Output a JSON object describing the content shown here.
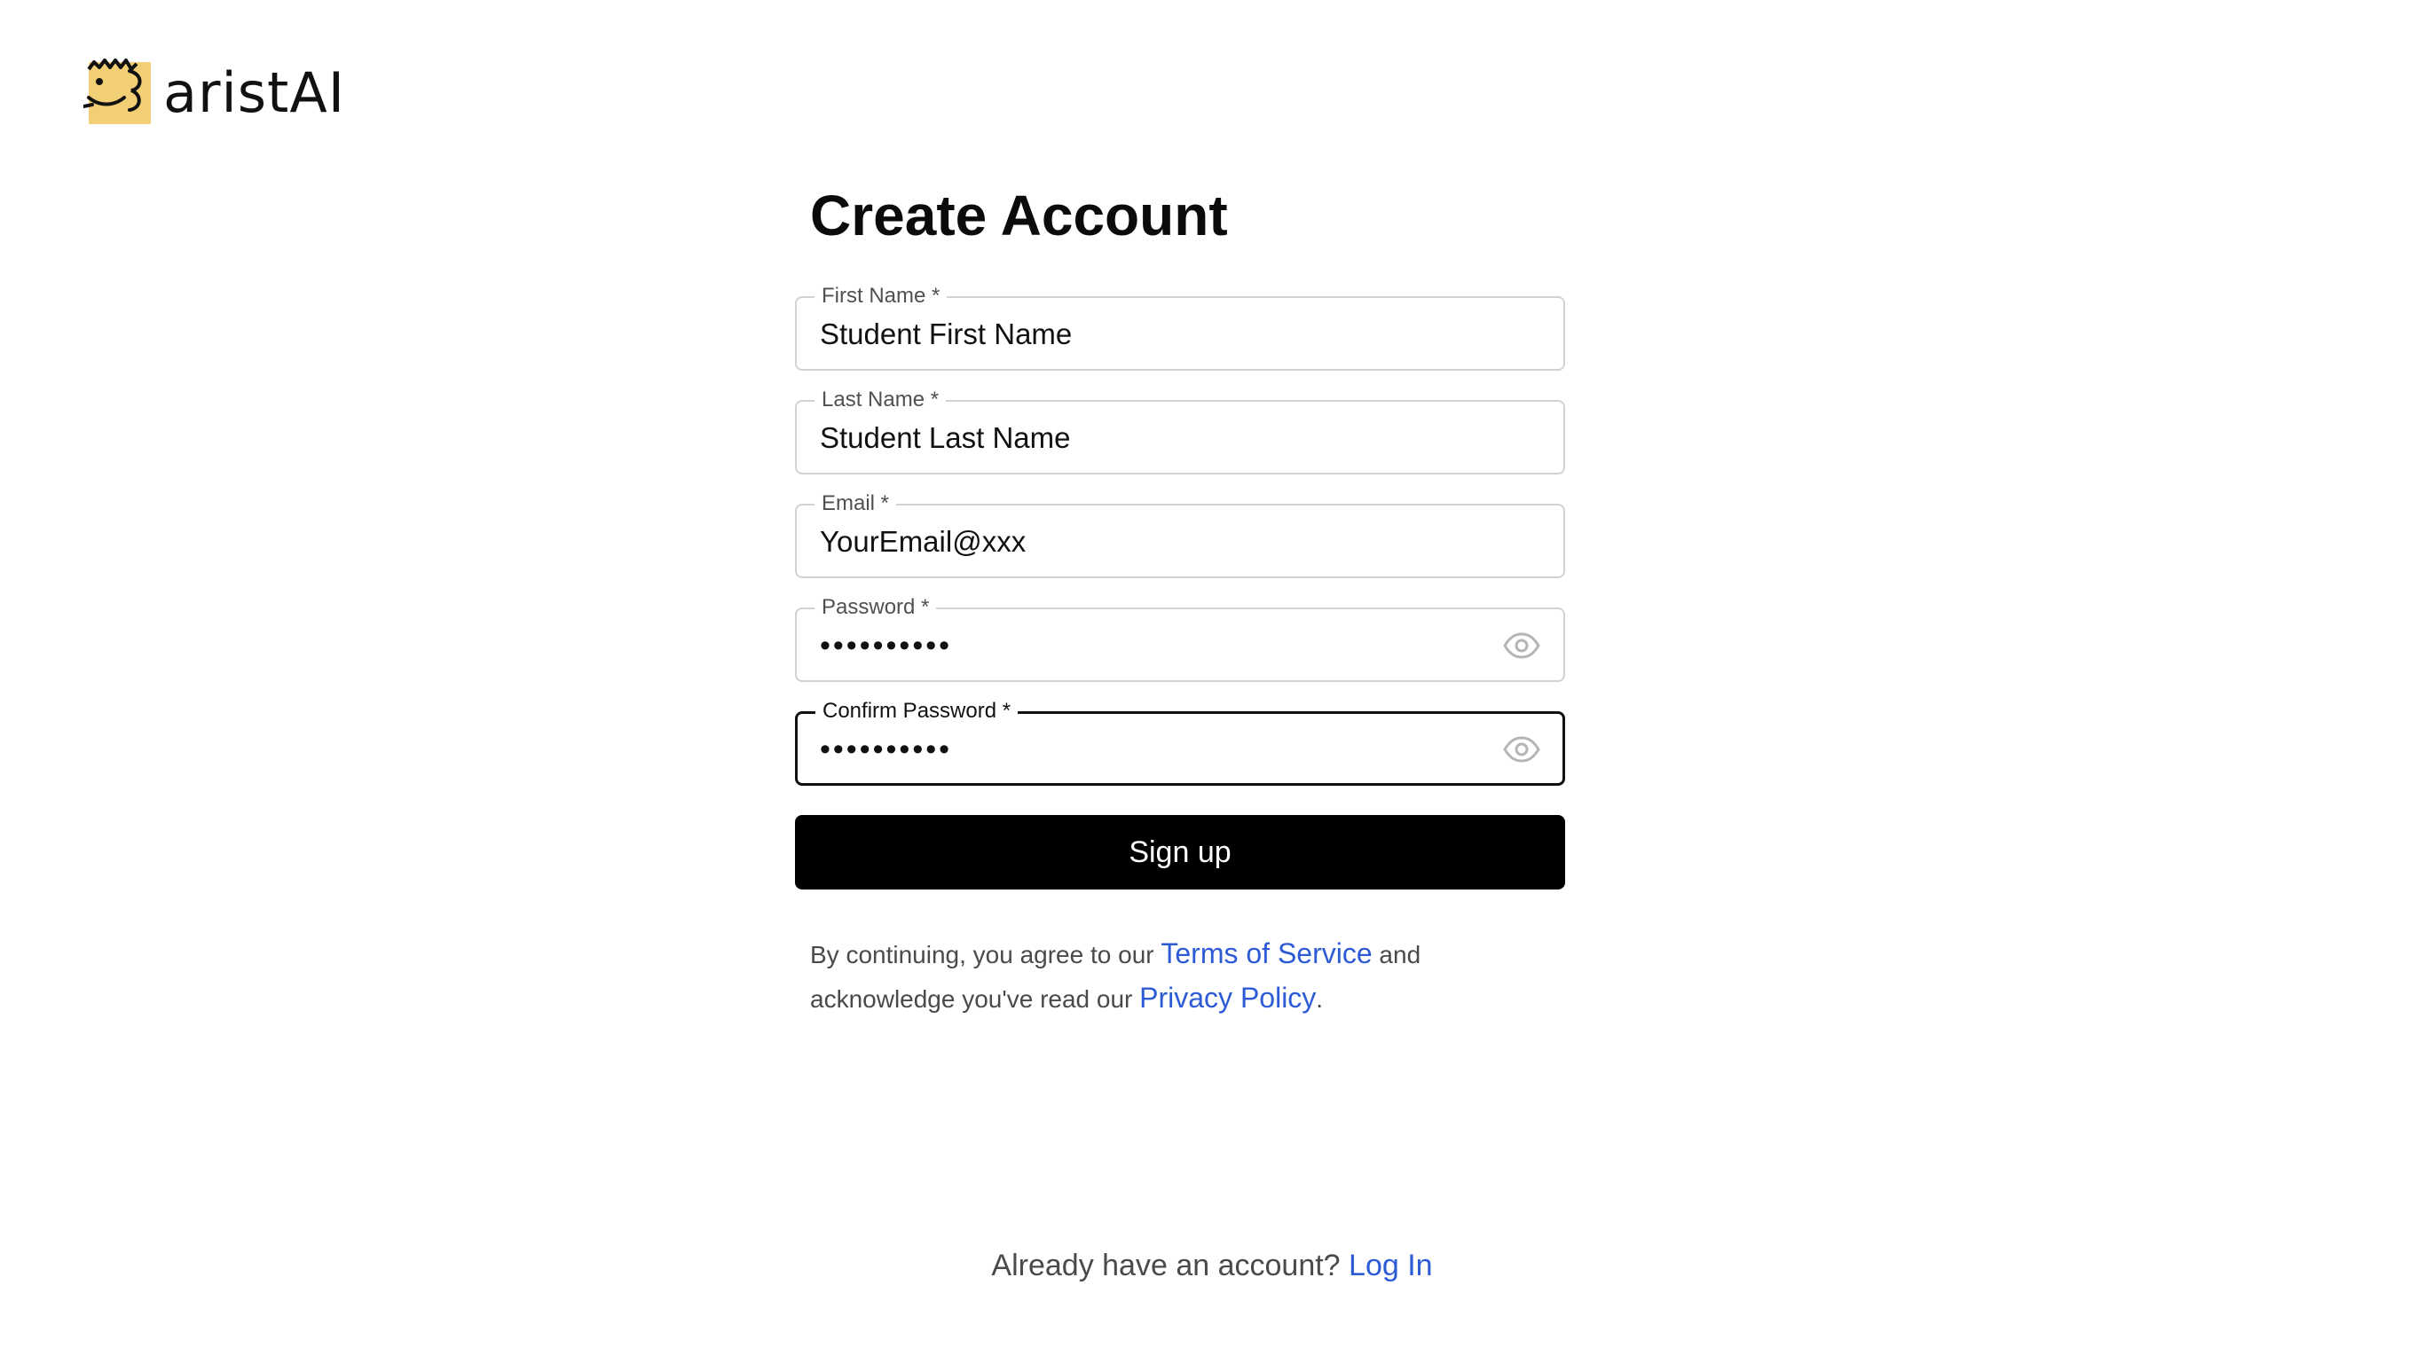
{
  "brand": {
    "logo_text": "aristAI",
    "logo_icon": "smiling-face-logo-icon",
    "logo_color": "#f2cf75"
  },
  "form": {
    "title": "Create Account",
    "fields": [
      {
        "label": "First Name *",
        "value": "Student First Name",
        "type": "text"
      },
      {
        "label": "Last Name *",
        "value": "Student Last Name",
        "type": "text"
      },
      {
        "label": "Email *",
        "value": "YourEmail@xxx",
        "type": "email"
      },
      {
        "label": "Password *",
        "value": "••••••••••",
        "type": "password",
        "icon": "eye-icon"
      },
      {
        "label": "Confirm Password *",
        "value": "••••••••••",
        "type": "password",
        "icon": "eye-icon",
        "focused": true
      }
    ],
    "submit_label": "Sign up"
  },
  "legal": {
    "prefix": "By continuing, you agree to our ",
    "terms_link": "Terms of Service",
    "middle": " and acknowledge you've read our ",
    "privacy_link": "Privacy Policy",
    "suffix": "."
  },
  "footer": {
    "prompt": "Already have an account? ",
    "login_link": "Log In"
  },
  "colors": {
    "link": "#2d5bd6",
    "button_bg": "#000000",
    "input_border": "#d2d2d2",
    "focused_border": "#111111"
  }
}
